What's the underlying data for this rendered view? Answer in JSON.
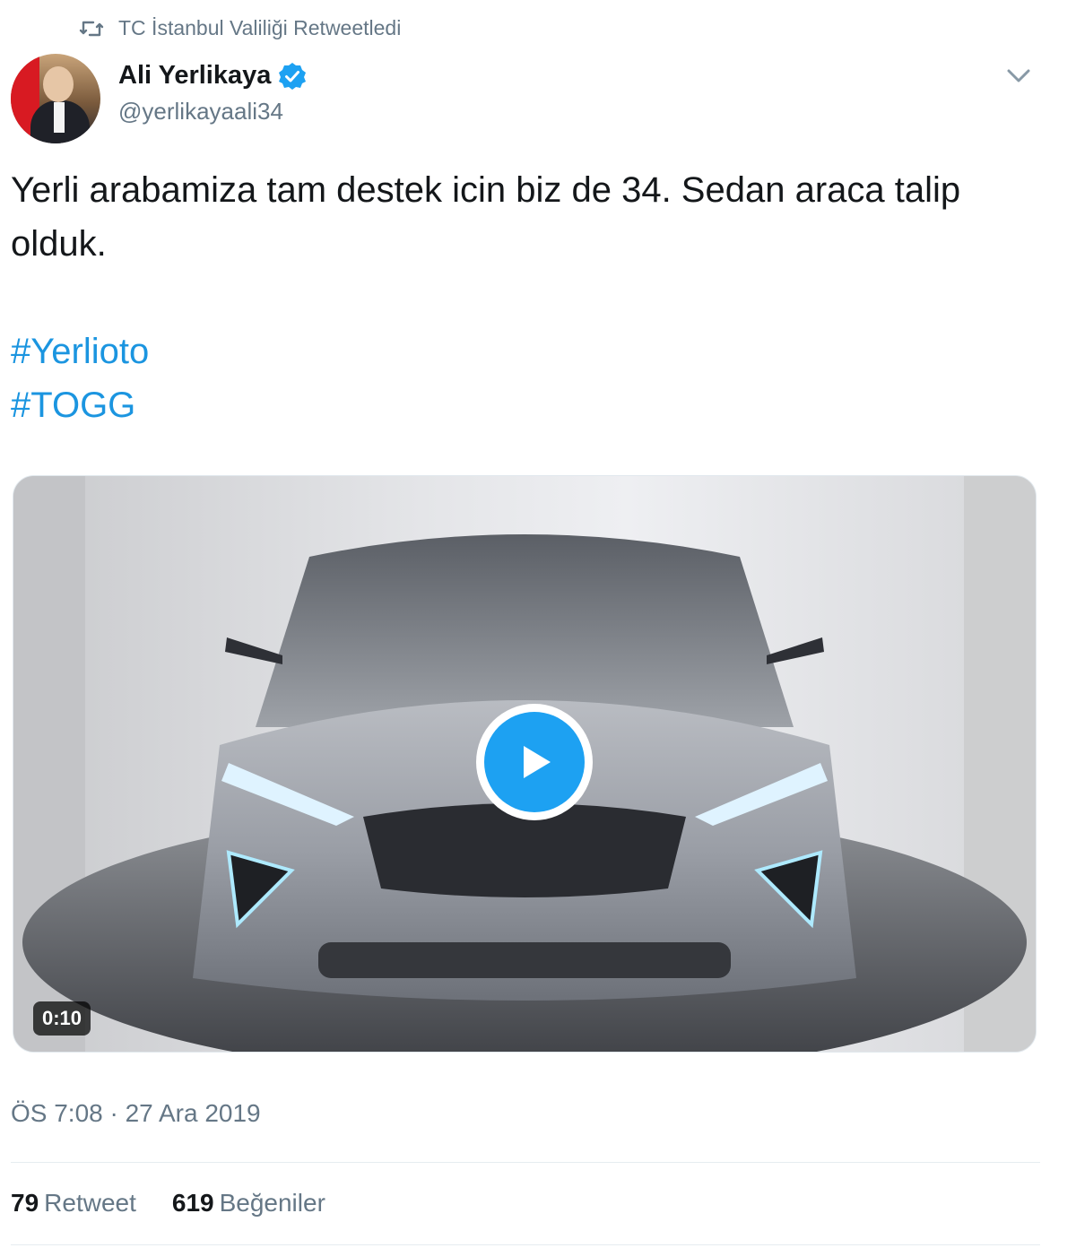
{
  "retweet": {
    "icon": "retweet-icon",
    "text": "TC İstanbul Valiliği Retweetledi"
  },
  "author": {
    "display_name": "Ali Yerlikaya",
    "handle": "@yerlikayaali34",
    "verified_icon": "verified-badge-icon"
  },
  "tweet": {
    "text": "Yerli arabamiza tam destek icin biz de 34. Sedan araca talip olduk.",
    "hashtags": [
      "#Yerlioto",
      "#TOGG"
    ]
  },
  "media": {
    "duration": "0:10",
    "play_icon": "play-icon"
  },
  "timestamp": "ÖS 7:08 · 27 Ara 2019",
  "stats": {
    "retweets_count": "79",
    "retweets_label": "Retweet",
    "likes_count": "619",
    "likes_label": "Beğeniler"
  },
  "colors": {
    "link": "#1b95e0",
    "secondary_text": "#657786",
    "play_blue": "#1da1f2"
  }
}
